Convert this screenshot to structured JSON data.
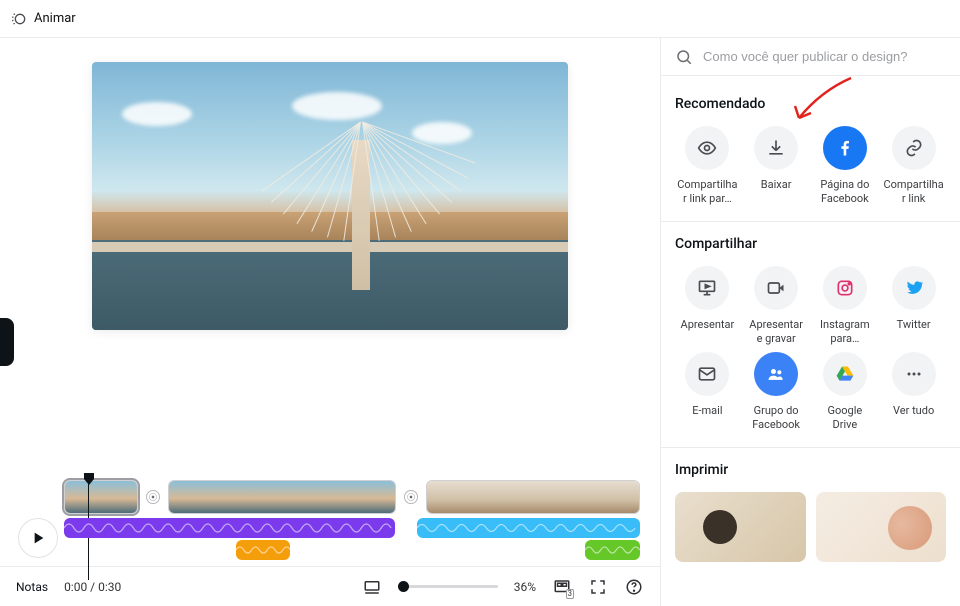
{
  "topbar": {
    "animar": "Animar"
  },
  "panel": {
    "search_placeholder": "Como você quer publicar o design?",
    "sections": {
      "recommended_title": "Recomendado",
      "share_title": "Compartilhar",
      "print_title": "Imprimir"
    },
    "recommended": [
      {
        "label": "Compartilhar link par…",
        "icon": "eye"
      },
      {
        "label": "Baixar",
        "icon": "download"
      },
      {
        "label": "Página do Facebook",
        "icon": "facebook"
      },
      {
        "label": "Compartilhar link",
        "icon": "link"
      }
    ],
    "share": [
      {
        "label": "Apresentar",
        "icon": "present"
      },
      {
        "label": "Apresentar e gravar",
        "icon": "record"
      },
      {
        "label": "Instagram para…",
        "icon": "instagram"
      },
      {
        "label": "Twitter",
        "icon": "twitter"
      },
      {
        "label": "E-mail",
        "icon": "email"
      },
      {
        "label": "Grupo do Facebook",
        "icon": "fbgroup"
      },
      {
        "label": "Google Drive",
        "icon": "gdrive"
      },
      {
        "label": "Ver tudo",
        "icon": "more"
      }
    ]
  },
  "bottombar": {
    "notas": "Notas",
    "time": "0:00 / 0:30",
    "zoom": "36%",
    "page_count": "3"
  },
  "colors": {
    "facebook": "#1877F2",
    "twitter": "#1DA1F2",
    "instagram_stroke": "#E1306C",
    "fbgroup": "#3b82f6",
    "audio_purple": "#7C3AED",
    "audio_cyan": "#38BDF8",
    "audio_orange": "#F59E0B",
    "audio_green": "#65C728",
    "arrow": "#E3231E"
  }
}
